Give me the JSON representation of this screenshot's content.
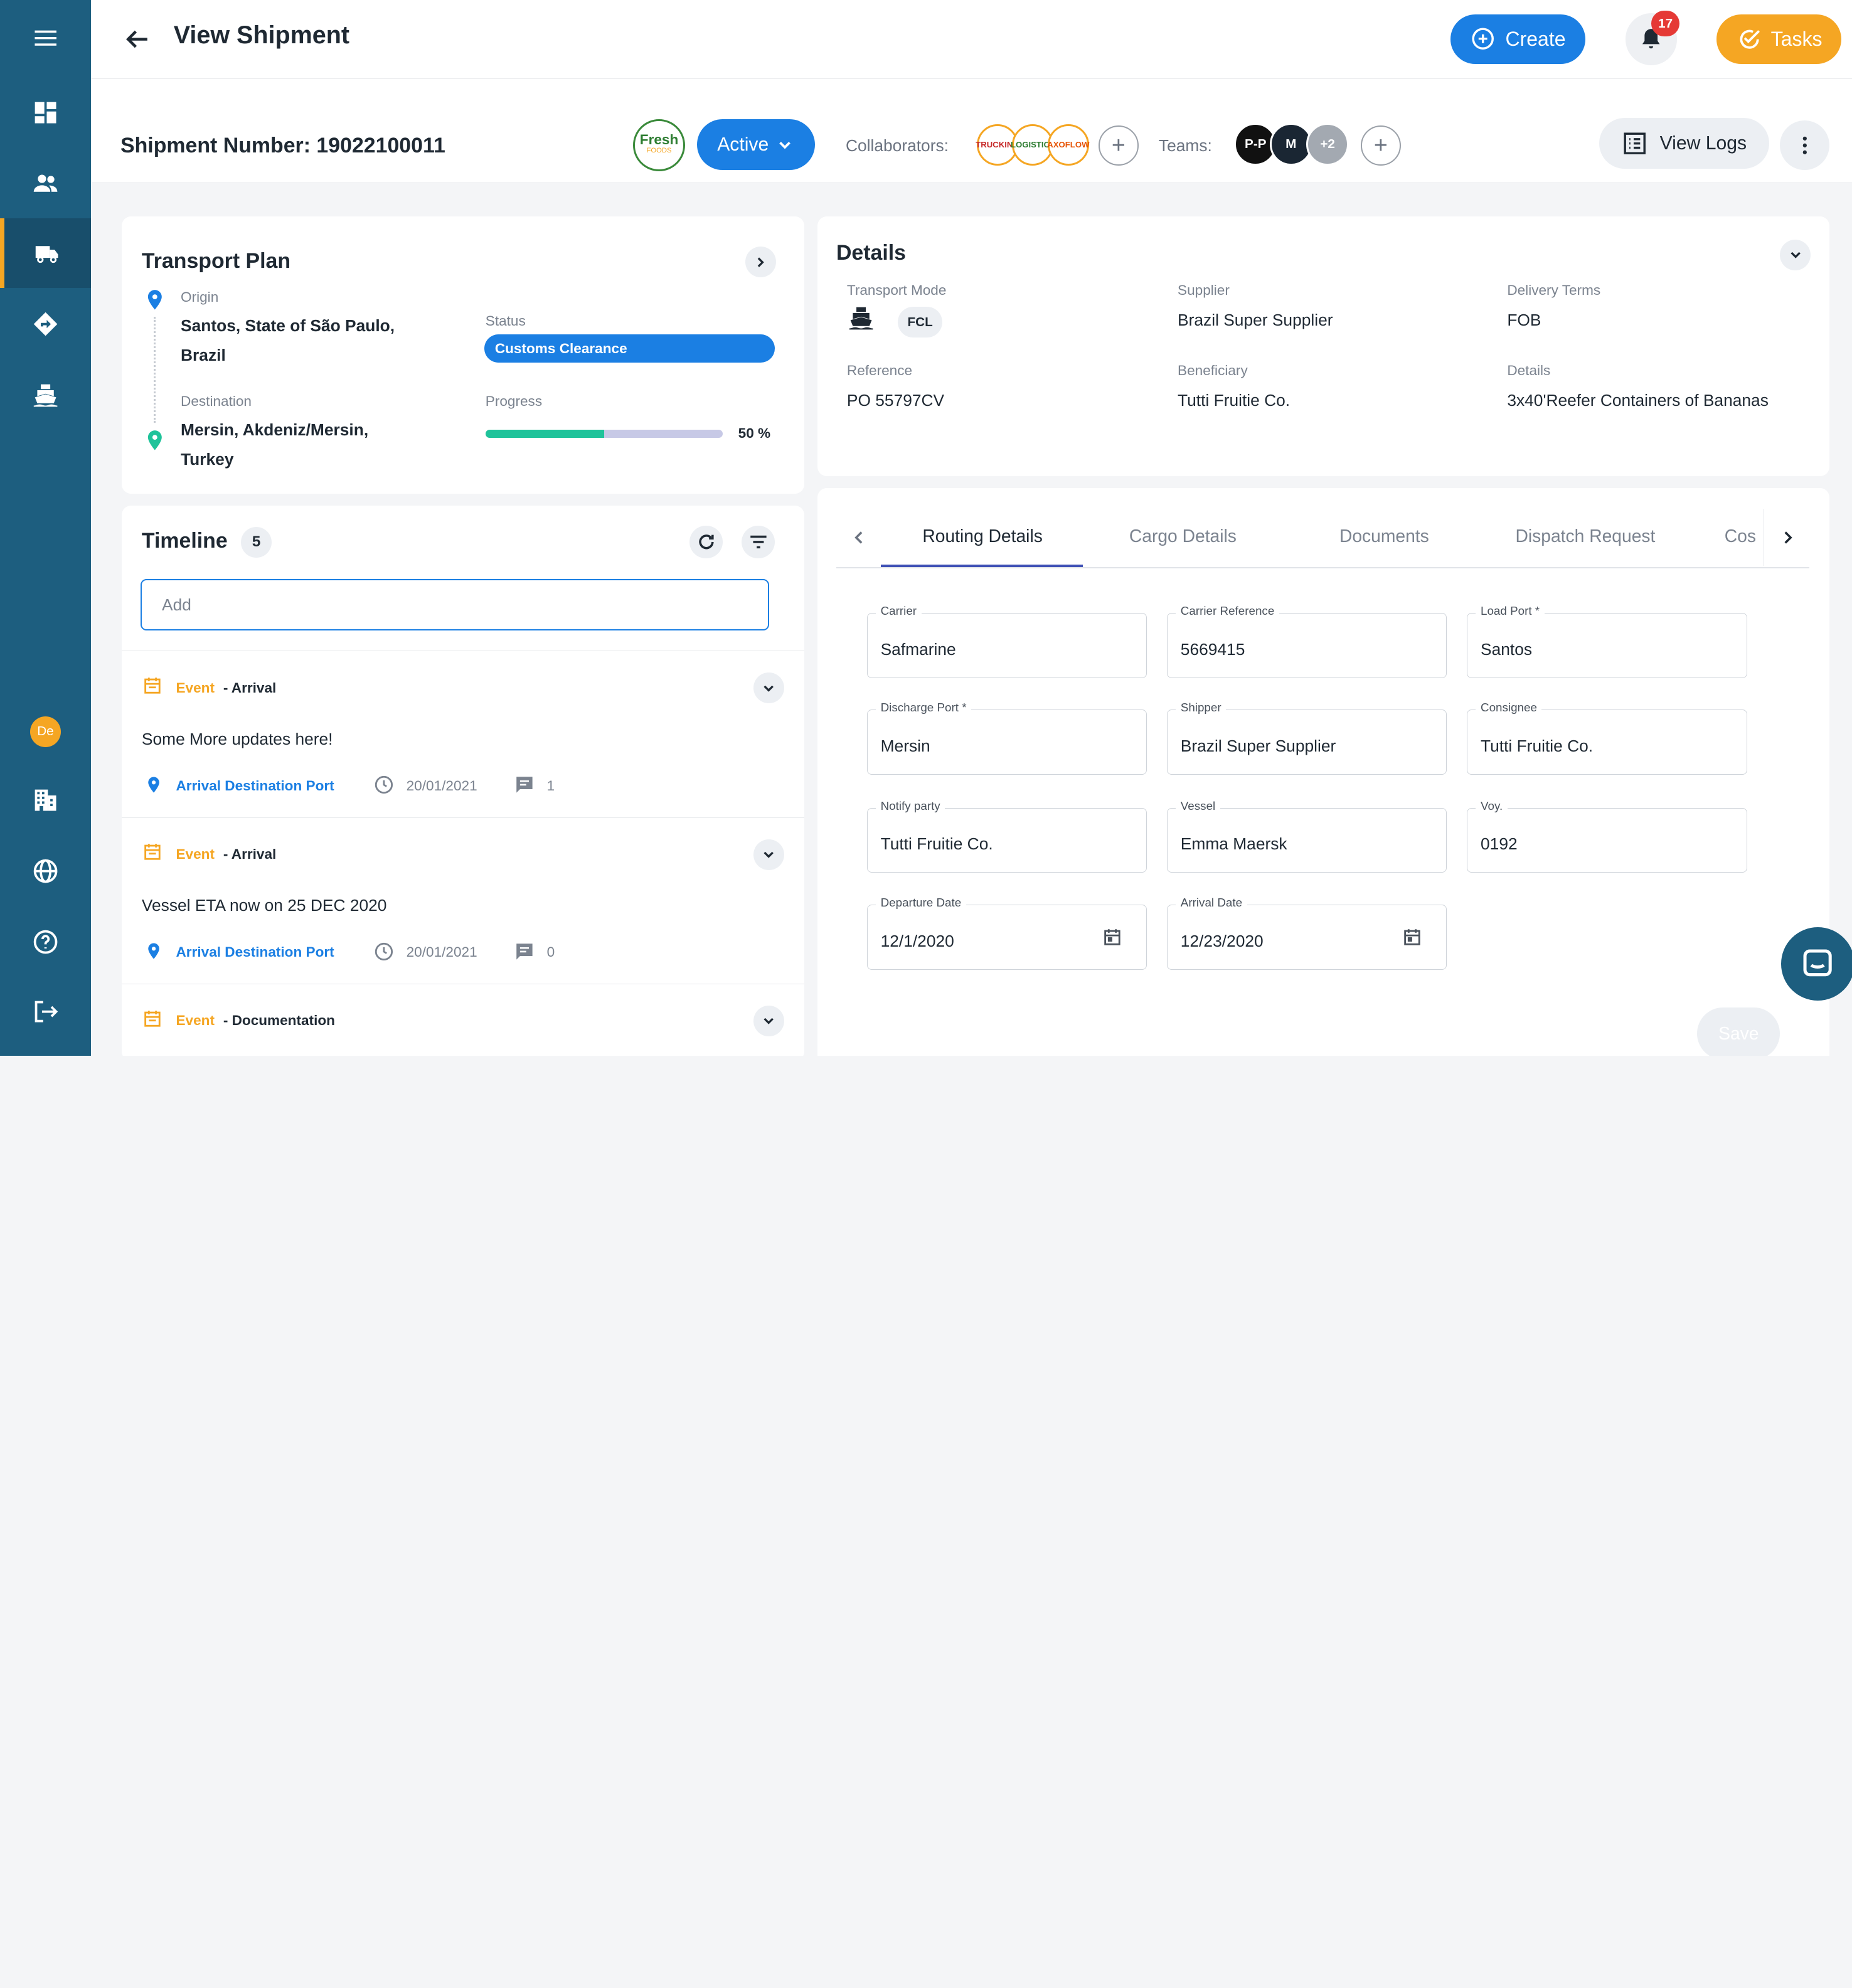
{
  "sidebar": {
    "avatar_initials": "De",
    "items": [
      {
        "icon": "dashboard-icon"
      },
      {
        "icon": "people-icon"
      },
      {
        "icon": "truck-icon"
      },
      {
        "icon": "route-icon"
      },
      {
        "icon": "ship-icon"
      },
      {
        "icon": "building-icon"
      },
      {
        "icon": "globe-icon"
      },
      {
        "icon": "help-icon"
      },
      {
        "icon": "logout-icon"
      }
    ]
  },
  "header": {
    "title": "View Shipment",
    "create_label": "Create",
    "notifications_count": "17",
    "tasks_label": "Tasks"
  },
  "subheader": {
    "shipment_number": "Shipment Number: 19022100011",
    "logo_text": "Fresh",
    "logo_subtext": "FOODS",
    "status": "Active",
    "collaborators_label": "Collaborators:",
    "collaborators": [
      "TRUCKING",
      "LOGISTICS",
      "AXOFLOW"
    ],
    "teams_label": "Teams:",
    "teams": [
      "P-P",
      "M",
      "+2"
    ],
    "view_logs_label": "View Logs"
  },
  "transport_plan": {
    "title": "Transport Plan",
    "origin_label": "Origin",
    "origin_line1": "Santos, State of São Paulo,",
    "origin_line2": "Brazil",
    "destination_label": "Destination",
    "destination_line1": "Mersin, Akdeniz/Mersin,",
    "destination_line2": "Turkey",
    "status_label": "Status",
    "status_value": "Customs Clearance",
    "progress_label": "Progress",
    "progress_value": 50,
    "progress_text": "50 %"
  },
  "timeline": {
    "title": "Timeline",
    "count": "5",
    "add_placeholder": "Add",
    "events": [
      {
        "kind": "Event",
        "type": "- Arrival",
        "text": "Some More updates here!",
        "location": "Arrival Destination Port",
        "date": "20/01/2021",
        "comments": "1"
      },
      {
        "kind": "Event",
        "type": "- Arrival",
        "text": "Vessel ETA now on 25 DEC 2020",
        "location": "Arrival Destination Port",
        "date": "20/01/2021",
        "comments": "0"
      },
      {
        "kind": "Event",
        "type": "- Documentation"
      }
    ]
  },
  "details": {
    "title": "Details",
    "transport_mode_label": "Transport Mode",
    "transport_mode_chip": "FCL",
    "supplier_label": "Supplier",
    "supplier": "Brazil Super Supplier",
    "delivery_terms_label": "Delivery Terms",
    "delivery_terms": "FOB",
    "reference_label": "Reference",
    "reference": "PO 55797CV",
    "beneficiary_label": "Beneficiary",
    "beneficiary": "Tutti Fruitie Co.",
    "details_label": "Details",
    "details_value": "3x40'Reefer Containers of Bananas"
  },
  "tabs": [
    "Routing Details",
    "Cargo Details",
    "Documents",
    "Dispatch Request",
    "Cos"
  ],
  "routing": {
    "fields": [
      {
        "label": "Carrier",
        "value": "Safmarine"
      },
      {
        "label": "Carrier Reference",
        "value": "5669415"
      },
      {
        "label": "Load Port *",
        "value": "Santos"
      },
      {
        "label": "Discharge Port *",
        "value": "Mersin"
      },
      {
        "label": "Shipper",
        "value": "Brazil Super Supplier"
      },
      {
        "label": "Consignee",
        "value": "Tutti Fruitie Co."
      },
      {
        "label": "Notify party",
        "value": "Tutti Fruitie Co."
      },
      {
        "label": "Vessel",
        "value": "Emma Maersk"
      },
      {
        "label": "Voy.",
        "value": "0192"
      },
      {
        "label": "Departure Date",
        "value": "12/1/2020"
      },
      {
        "label": "Arrival Date",
        "value": "12/23/2020"
      }
    ],
    "save_label": "Save"
  },
  "colors": {
    "sidebar": "#1d5e7f",
    "primary": "#1b7fe3",
    "accent": "#f5a623",
    "progress": "#1fc39a"
  }
}
